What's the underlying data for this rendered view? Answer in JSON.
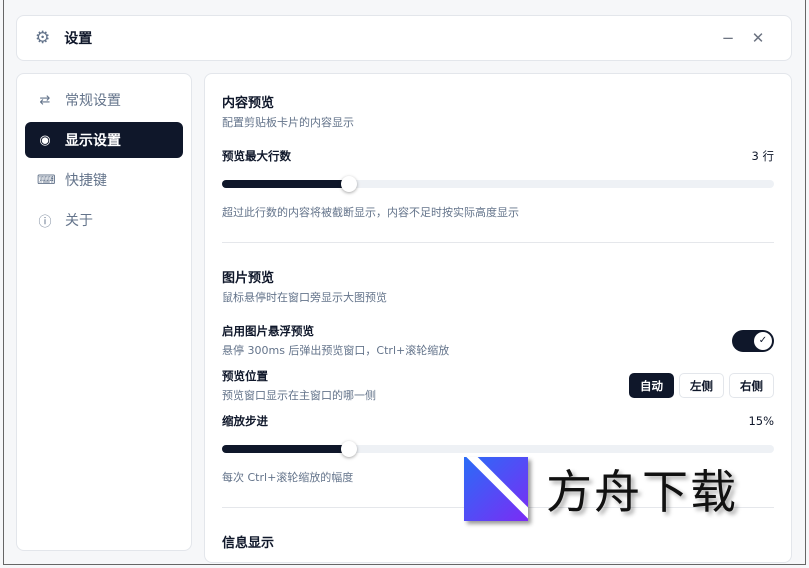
{
  "header": {
    "title": "设置",
    "minimize": "−",
    "close": "✕"
  },
  "sidebar": {
    "items": [
      {
        "label": "常规设置",
        "icon": "sliders-icon",
        "glyph": "⇄"
      },
      {
        "label": "显示设置",
        "icon": "eye-icon",
        "glyph": "◉"
      },
      {
        "label": "快捷键",
        "icon": "keyboard-icon",
        "glyph": "⌨"
      },
      {
        "label": "关于",
        "icon": "info-icon",
        "glyph": "ⓘ"
      }
    ],
    "active": 1
  },
  "content_preview": {
    "title": "内容预览",
    "desc": "配置剪贴板卡片的内容显示",
    "max_lines_label": "预览最大行数",
    "max_lines_value": "3 行",
    "max_lines_fraction": 0.23,
    "hint": "超过此行数的内容将被截断显示，内容不足时按实际高度显示"
  },
  "image_preview": {
    "title": "图片预览",
    "desc": "鼠标悬停时在窗口旁显示大图预览",
    "float_label": "启用图片悬浮预览",
    "float_desc": "悬停 300ms 后弹出预览窗口，Ctrl+滚轮缩放",
    "float_enabled": true,
    "position_label": "预览位置",
    "position_desc": "预览窗口显示在主窗口的哪一侧",
    "position_options": [
      "自动",
      "左侧",
      "右侧"
    ],
    "position_selected": 0,
    "zoom_label": "缩放步进",
    "zoom_value": "15%",
    "zoom_fraction": 0.23,
    "zoom_hint": "每次 Ctrl+滚轮缩放的幅度"
  },
  "info_display": {
    "title": "信息显示"
  },
  "watermark": {
    "text": "方舟下载"
  }
}
